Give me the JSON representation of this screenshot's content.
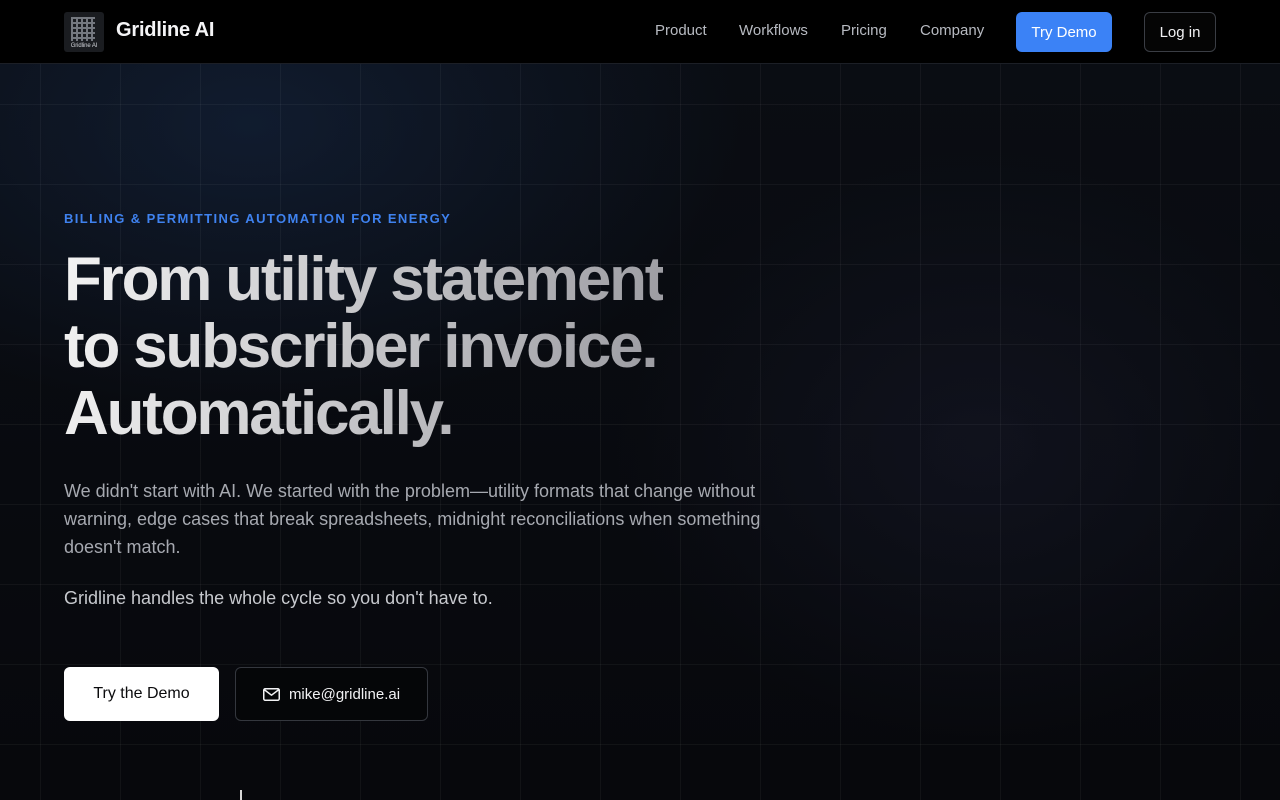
{
  "nav": {
    "logo_text": "Gridline AI",
    "brand": "Gridline AI",
    "links": [
      "Product",
      "Workflows",
      "Pricing",
      "Company"
    ],
    "try_demo": "Try Demo",
    "login": "Log in"
  },
  "hero": {
    "eyebrow": "BILLING & PERMITTING AUTOMATION FOR ENERGY",
    "headline": [
      "From utility statement",
      "to subscriber invoice.",
      "Automatically."
    ],
    "lead": "We didn't start with AI. We started with the problem—utility formats that change without warning, edge cases that break spreadsheets, midnight reconciliations when something doesn't match.",
    "sub": "Gridline handles the whole cycle so you don't have to.",
    "primary_cta": "Try the Demo",
    "email_cta": "mike@gridline.ai"
  },
  "colors": {
    "accent": "#3b82f6",
    "background": "#07090d",
    "eyebrow": "#3f82ef"
  },
  "icons": {
    "logo": "gridline-logo-icon",
    "email": "mail-icon"
  }
}
